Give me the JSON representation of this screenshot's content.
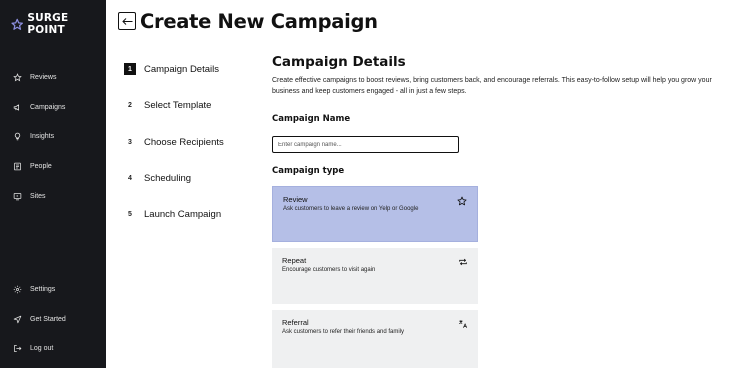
{
  "brand": {
    "name": "SURGE POINT"
  },
  "sidebar": {
    "items": [
      {
        "label": "Reviews",
        "icon": "star-icon"
      },
      {
        "label": "Campaigns",
        "icon": "megaphone-icon"
      },
      {
        "label": "Insights",
        "icon": "lightbulb-icon"
      },
      {
        "label": "People",
        "icon": "contacts-icon"
      },
      {
        "label": "Sites",
        "icon": "monitor-icon"
      }
    ],
    "bottom_items": [
      {
        "label": "Settings",
        "icon": "gear-icon"
      },
      {
        "label": "Get Started",
        "icon": "send-icon"
      },
      {
        "label": "Log out",
        "icon": "logout-icon"
      }
    ]
  },
  "header": {
    "title": "Create New Campaign"
  },
  "steps": [
    {
      "num": "1",
      "label": "Campaign Details",
      "active": true
    },
    {
      "num": "2",
      "label": "Select Template"
    },
    {
      "num": "3",
      "label": "Choose Recipients"
    },
    {
      "num": "4",
      "label": "Scheduling"
    },
    {
      "num": "5",
      "label": "Launch Campaign"
    }
  ],
  "main": {
    "title": "Campaign Details",
    "description": "Create effective campaigns to boost reviews, bring customers back, and encourage referrals. This easy-to-follow setup will help you grow your business and keep customers engaged - all in just a few steps.",
    "campaign_name": {
      "label": "Campaign Name",
      "value": "",
      "placeholder": "Enter campaign name..."
    },
    "campaign_type": {
      "label": "Campaign type",
      "options": [
        {
          "title": "Review",
          "desc": "Ask customers to leave a review on Yelp or Google",
          "icon": "star-outline-icon",
          "selected": true
        },
        {
          "title": "Repeat",
          "desc": "Encourage customers to visit again",
          "icon": "repeat-icon"
        },
        {
          "title": "Referral",
          "desc": "Ask customers to refer their friends and family",
          "icon": "translate-icon"
        }
      ]
    }
  },
  "colors": {
    "sidebar_bg": "#17181c",
    "selected_card": "#b5bfe7",
    "card_bg": "#eff0f1",
    "brand_star": "#8d8fe0"
  }
}
